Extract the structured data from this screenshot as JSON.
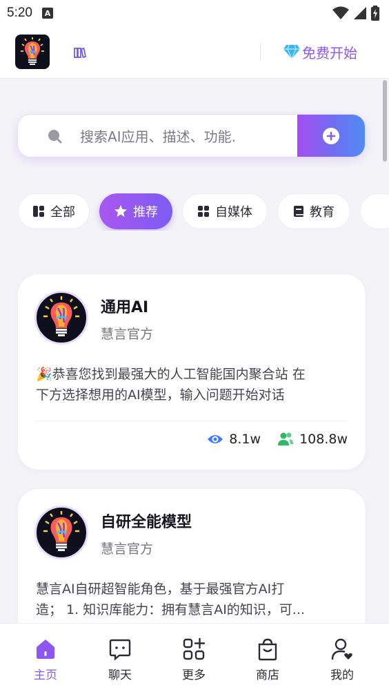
{
  "status_bar": {
    "time": "5:20",
    "notification_letter": "A"
  },
  "header": {
    "start_label": "免费开始",
    "colors": {
      "accent": "#8e56f5"
    }
  },
  "search": {
    "placeholder": "搜索AI应用、描述、功能."
  },
  "categories": [
    {
      "label": "全部",
      "icon": "grid-icon",
      "active": false
    },
    {
      "label": "推荐",
      "icon": "star-icon",
      "active": true
    },
    {
      "label": "自媒体",
      "icon": "apps-icon",
      "active": false
    },
    {
      "label": "教育",
      "icon": "book-icon",
      "active": false
    }
  ],
  "cards": [
    {
      "title": "通用AI",
      "author": "慧言官方",
      "description_line1": "🎉恭喜您找到最强大的人工智能国内聚合站 在",
      "description_line2": "下方选择想用的AI模型，输入问题开始对话",
      "views": "8.1w",
      "users": "108.8w"
    },
    {
      "title": "自研全能模型",
      "author": "慧言官方",
      "description_line1": "慧言AI自研超智能角色，基于最强官方AI打",
      "description_line2": "造； 1. 知识库能力：拥有慧言AI的知识，可..."
    }
  ],
  "bottom_nav": [
    {
      "label": "主页",
      "icon": "home-icon",
      "active": true
    },
    {
      "label": "聊天",
      "icon": "chat-icon",
      "active": false
    },
    {
      "label": "更多",
      "icon": "more-apps-icon",
      "active": false
    },
    {
      "label": "商店",
      "icon": "shopping-bag-icon",
      "active": false
    },
    {
      "label": "我的",
      "icon": "user-icon",
      "active": false
    }
  ]
}
